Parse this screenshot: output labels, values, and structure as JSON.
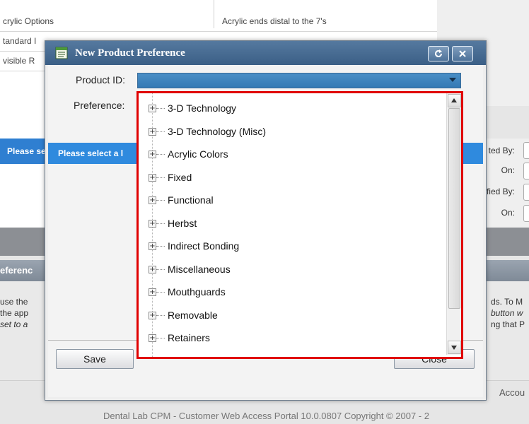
{
  "background": {
    "table": {
      "rows": [
        {
          "col1": "crylic Options",
          "col2": "Acrylic ends distal to the 7's"
        },
        {
          "col1": "tandard I",
          "col2": ""
        },
        {
          "col1": "visible R",
          "col2": ""
        }
      ]
    },
    "selected_row_text": "Please select a l",
    "side_form": {
      "created_by_label": "ted By:",
      "created_on_label": "On:",
      "modified_by_label": "fied By:",
      "modified_on_label": "On:"
    },
    "preferences_header": "eferenc",
    "info_left": [
      "use the",
      "the app",
      "set to a"
    ],
    "info_right": [
      "ds. To M",
      "button w",
      "ng that P"
    ],
    "footer_account": "Accou",
    "footer_copyright": "Dental Lab CPM - Customer Web Access Portal 10.0.0807   Copyright © 2007 - 2"
  },
  "dialog": {
    "title": "New Product Preference",
    "icon": "form-icon",
    "refresh_icon": "refresh-icon",
    "close_icon": "close-icon",
    "product_id_label": "Product ID:",
    "preference_label": "Preference:",
    "stripe_text": "Please select a l",
    "save_label": "Save",
    "close_label": "Close"
  },
  "tree": {
    "items": [
      {
        "label": "3-D Technology"
      },
      {
        "label": "3-D Technology (Misc)"
      },
      {
        "label": "Acrylic Colors"
      },
      {
        "label": "Fixed"
      },
      {
        "label": "Functional"
      },
      {
        "label": "Herbst"
      },
      {
        "label": "Indirect Bonding"
      },
      {
        "label": "Miscellaneous"
      },
      {
        "label": "Mouthguards"
      },
      {
        "label": "Removable"
      },
      {
        "label": "Retainers"
      }
    ],
    "expander_glyph": "+"
  },
  "colors": {
    "highlight_border": "#e00000",
    "titlebar": "#3b5f86",
    "selection_blue": "#2f8ade"
  }
}
